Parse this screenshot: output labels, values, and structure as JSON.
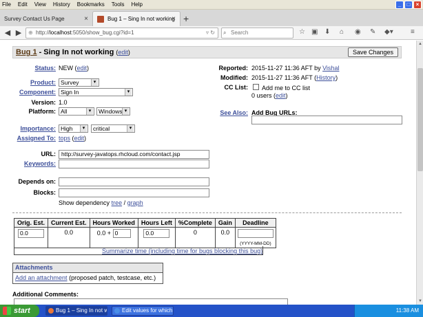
{
  "menu": [
    "File",
    "Edit",
    "View",
    "History",
    "Bookmarks",
    "Tools",
    "Help"
  ],
  "tabs": [
    {
      "label": "Survey Contact Us Page",
      "active": false
    },
    {
      "label": "Bug 1 – Sing In not working",
      "active": true
    }
  ],
  "nav": {
    "url_host": "localhost",
    "url_prefix": "http://",
    "url_path": ":5050/show_bug.cgi?id=1",
    "search_placeholder": "Search"
  },
  "bug": {
    "id_label": "Bug 1",
    "title": "- Sing In not working",
    "edit": "edit",
    "save_button": "Save Changes"
  },
  "fields": {
    "status_label": "Status",
    "status_value": "NEW",
    "status_edit": "edit",
    "product_label": "Product",
    "product_value": "Survey",
    "component_label": "Component",
    "component_value": "Sign In",
    "version_label": "Version",
    "version_value": "1.0",
    "platform_label": "Platform",
    "platform_value": "All",
    "os_value": "Windows",
    "importance_label": "Importance",
    "priority_value": "High",
    "severity_value": "critical",
    "assigned_label": "Assigned To",
    "assigned_value": "tops",
    "assigned_edit": "edit",
    "url_label": "URL",
    "url_value": "http://survey-javatops.rhcloud.com/contact.jsp",
    "keywords_label": "Keywords",
    "keywords_value": "",
    "depends_label": "Depends on",
    "blocks_label": "Blocks",
    "dependency_text": "Show dependency",
    "tree_link": "tree",
    "graph_link": "graph"
  },
  "right": {
    "reported_label": "Reported",
    "reported_value": "2015-11-27 11:36 AFT by",
    "reported_by": "Vishal",
    "modified_label": "Modified",
    "modified_value": "2015-11-27 11:36 AFT",
    "history_link": "History",
    "cc_label": "CC List",
    "cc_checkbox_label": "Add me to CC list",
    "cc_users": "0 users",
    "cc_edit": "edit",
    "see_also_label": "See Also",
    "add_bug_urls": "Add Bug URLs:"
  },
  "time": {
    "headers": [
      "Orig. Est.",
      "Current Est.",
      "Hours Worked",
      "Hours Left",
      "%Complete",
      "Gain",
      "Deadline"
    ],
    "orig_est": "0.0",
    "current_est": "0.0",
    "hours_worked": "0.0 +",
    "hours_add": "0",
    "hours_left": "0.0",
    "complete": "0",
    "gain": "0.0",
    "deadline": "",
    "deadline_hint": "(YYYY-MM-DD)",
    "summarize_link": "Summarize time (including time for bugs blocking this bug)"
  },
  "attachments": {
    "title": "Attachments",
    "add_link": "Add an attachment",
    "add_hint": "(proposed patch, testcase, etc.)"
  },
  "comments": {
    "label": "Additional Comments:"
  },
  "taskbar": {
    "start": "start",
    "tasks": [
      "Bug 1 – Sing In not w...",
      "Edit values for which ..."
    ],
    "clock": "11:38 AM"
  }
}
